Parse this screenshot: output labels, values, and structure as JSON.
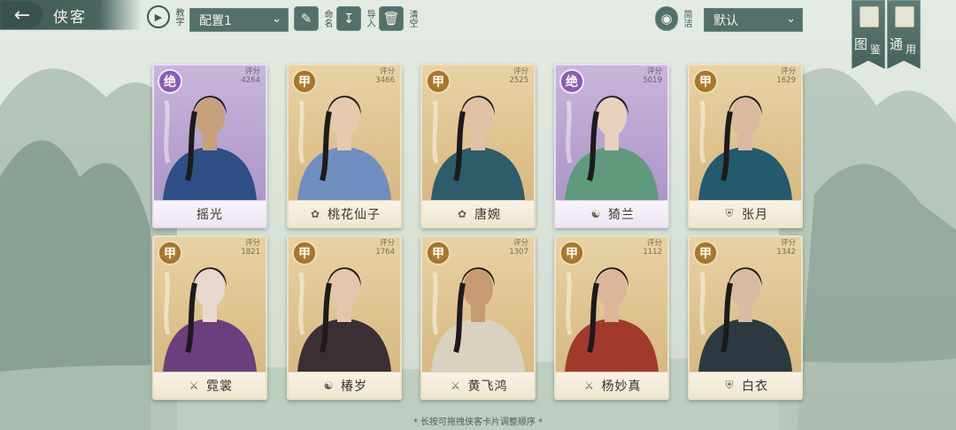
{
  "header": {
    "back_icon": "back-arrow-icon",
    "title": "侠客",
    "tutorial_label": "教学",
    "preset_value": "配置1",
    "rename_label": "命名",
    "import_label": "导入",
    "clear_label": "清空",
    "simple_label": "简洁",
    "sort_value": "默认",
    "codex_label_1": "图",
    "codex_label_2": "鉴",
    "general_label_1": "通",
    "general_label_2": "用"
  },
  "score_label": "评分",
  "cards": [
    {
      "name": "摇光",
      "rank": "绝",
      "tier": "jue",
      "score": "4264",
      "school_icon": "none"
    },
    {
      "name": "桃花仙子",
      "rank": "甲",
      "tier": "jia",
      "score": "3466",
      "school_icon": "lotus-icon"
    },
    {
      "name": "唐婉",
      "rank": "甲",
      "tier": "jia",
      "score": "2525",
      "school_icon": "lotus-icon"
    },
    {
      "name": "猗兰",
      "rank": "绝",
      "tier": "jue",
      "score": "5019",
      "school_icon": "yin-yang-icon"
    },
    {
      "name": "张月",
      "rank": "甲",
      "tier": "jia",
      "score": "1629",
      "school_icon": "shield-icon"
    },
    {
      "name": "霓裳",
      "rank": "甲",
      "tier": "jia",
      "score": "1821",
      "school_icon": "sword-icon"
    },
    {
      "name": "椿岁",
      "rank": "甲",
      "tier": "jia",
      "score": "1764",
      "school_icon": "yin-yang-icon"
    },
    {
      "name": "黄飞鸿",
      "rank": "甲",
      "tier": "jia",
      "score": "1307",
      "school_icon": "sword-icon"
    },
    {
      "name": "杨妙真",
      "rank": "甲",
      "tier": "jia",
      "score": "1112",
      "school_icon": "sword-icon"
    },
    {
      "name": "白衣",
      "rank": "甲",
      "tier": "jia",
      "score": "1342",
      "school_icon": "shield-icon"
    }
  ],
  "footer_hint": "* 长按可拖拽侠客卡片调整顺序 *"
}
